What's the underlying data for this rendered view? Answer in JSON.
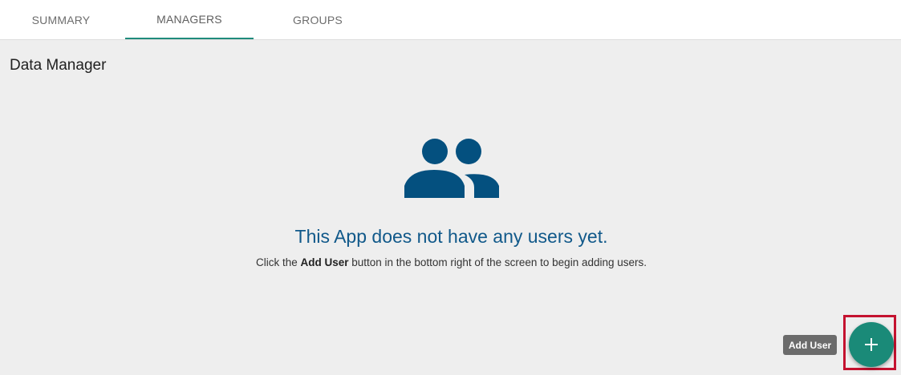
{
  "tabs": [
    {
      "label": "SUMMARY"
    },
    {
      "label": "MANAGERS"
    },
    {
      "label": "GROUPS"
    }
  ],
  "section": {
    "title": "Data Manager"
  },
  "empty_state": {
    "icon": "users-icon",
    "heading": "This App does not have any users yet.",
    "sub_prefix": "Click the ",
    "sub_bold": "Add User",
    "sub_suffix": " button in the bottom right of the screen to begin adding users."
  },
  "fab": {
    "tooltip": "Add User",
    "icon": "plus-icon"
  },
  "colors": {
    "accent": "#208b7c",
    "heading_blue": "#11598a",
    "icon_blue": "#04507f",
    "highlight_red": "#c4122f"
  }
}
